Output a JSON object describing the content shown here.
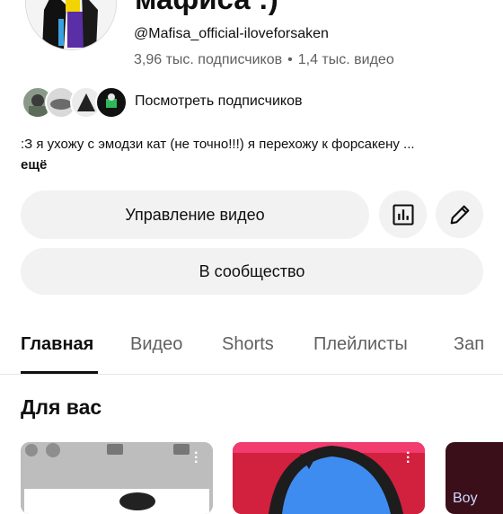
{
  "channel": {
    "name": "мафиса :)",
    "handle": "@Mafisa_official-iloveforsaken",
    "subscribers": "3,96 тыс. подписчиков",
    "separator": "•",
    "videos": "1,4 тыс. видео",
    "view_subscribers": "Посмотреть подписчиков",
    "description": ":З я ухожу с эмодзи кат (не точно!!!) я перехожу к форсакену ...",
    "more": "ещё"
  },
  "actions": {
    "manage_videos": "Управление видео",
    "community": "В сообщество"
  },
  "tabs": [
    {
      "label": "Главная",
      "active": true
    },
    {
      "label": "Видео",
      "active": false
    },
    {
      "label": "Shorts",
      "active": false
    },
    {
      "label": "Плейлисты",
      "active": false
    },
    {
      "label": "Зап",
      "active": false
    }
  ],
  "section": {
    "title": "Для вас",
    "thumb3_text": "Boy"
  },
  "colors": {
    "accent": "#0f0f0f",
    "secondary_text": "#606060",
    "button_bg": "#f2f2f2"
  },
  "icons": [
    "analytics-icon",
    "edit-pencil-icon",
    "more-vert-icon"
  ]
}
